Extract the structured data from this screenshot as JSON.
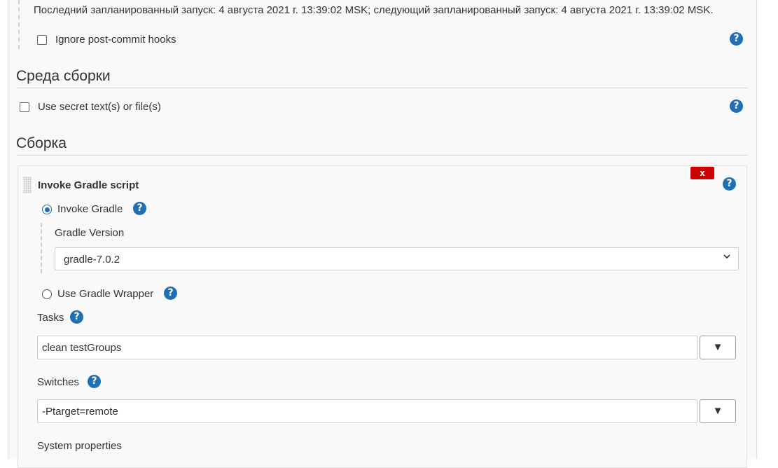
{
  "trigger": {
    "schedule_text": "Последний запланированный запуск: 4 августа 2021 г. 13:39:02 MSK; следующий запланированный запуск: 4 августа 2021 г. 13:39:02 MSK.",
    "ignore_hooks_label": "Ignore post-commit hooks"
  },
  "build_env": {
    "title": "Среда сборки",
    "secret_label": "Use secret text(s) or file(s)"
  },
  "build": {
    "title": "Сборка",
    "step_title": "Invoke Gradle script",
    "close_label": "x",
    "invoke_gradle_label": "Invoke Gradle",
    "gradle_version_label": "Gradle Version",
    "gradle_version_value": "gradle-7.0.2",
    "wrapper_label": "Use Gradle Wrapper",
    "tasks_label": "Tasks",
    "tasks_value": "clean testGroups",
    "switches_label": "Switches",
    "switches_value": "-Ptarget=remote",
    "system_properties_label": "System properties"
  },
  "icons": {
    "help": "question-circle-icon",
    "dropdown": "triangle-down-icon",
    "chevron": "chevron-down-icon"
  },
  "glyphs": {
    "help": "?",
    "dropdown": "▼",
    "chevron": "⌄"
  },
  "colors": {
    "accent": "#1f6fb2",
    "danger": "#cc0000"
  }
}
